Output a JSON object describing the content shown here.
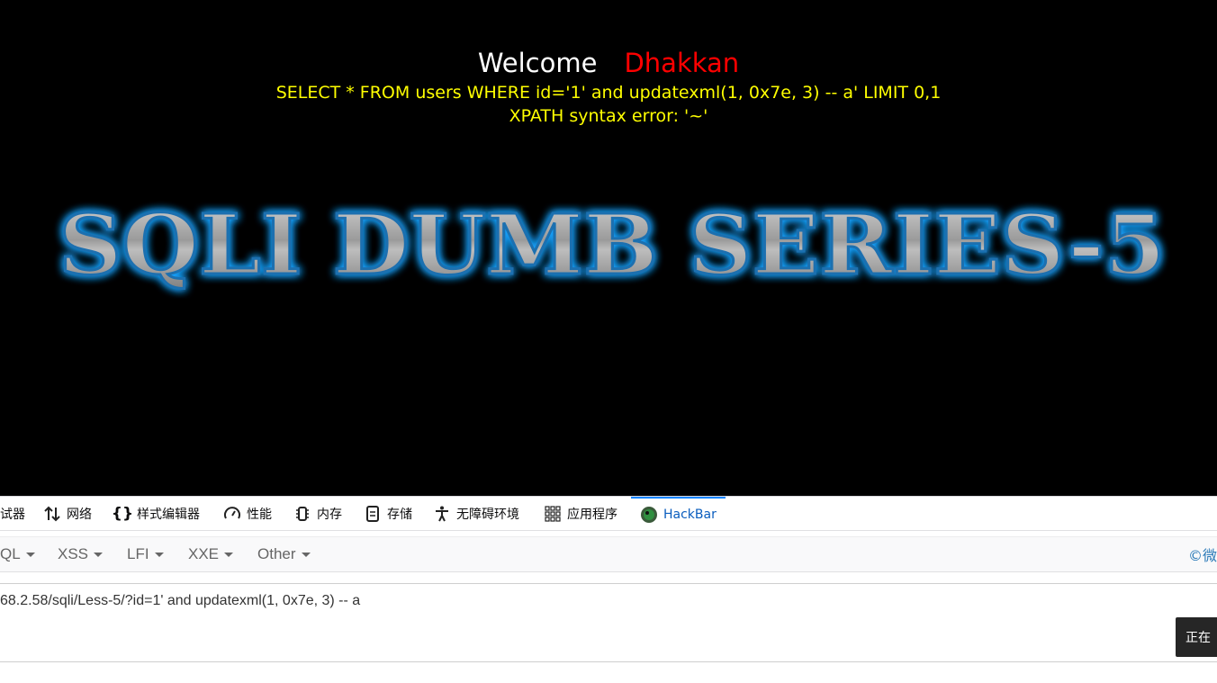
{
  "page": {
    "welcome": "Welcome",
    "user": "Dhakkan",
    "query": "SELECT * FROM users WHERE id='1' and updatexml(1, 0x7e, 3) -- a' LIMIT 0,1",
    "error": "XPATH syntax error: '~'",
    "banner_text": "SQLI DUMB SERIES-5"
  },
  "devtools": {
    "tabs": [
      {
        "label": "试器",
        "icon": "debugger-icon"
      },
      {
        "label": "网络",
        "icon": "network-icon"
      },
      {
        "label": "样式编辑器",
        "icon": "braces-icon"
      },
      {
        "label": "性能",
        "icon": "gauge-icon"
      },
      {
        "label": "内存",
        "icon": "memory-icon"
      },
      {
        "label": "存储",
        "icon": "storage-icon"
      },
      {
        "label": "无障碍环境",
        "icon": "accessibility-icon"
      },
      {
        "label": "应用程序",
        "icon": "grid-icon"
      },
      {
        "label": "HackBar",
        "icon": "hackbar-icon"
      }
    ],
    "active_tab": "HackBar"
  },
  "hackbar": {
    "menus": [
      "QL",
      "XSS",
      "LFI",
      "XXE",
      "Other"
    ],
    "copyright": "©微",
    "url": "68.2.58/sqli/Less-5/?id=1' and updatexml(1, 0x7e, 3) -- a",
    "tooltip": "正在"
  },
  "colors": {
    "welcome": "#ffffff",
    "user": "#ff0000",
    "query": "#ffff00",
    "tab_active": "#0a84ff",
    "banner_glow": "#1aa3ff"
  }
}
